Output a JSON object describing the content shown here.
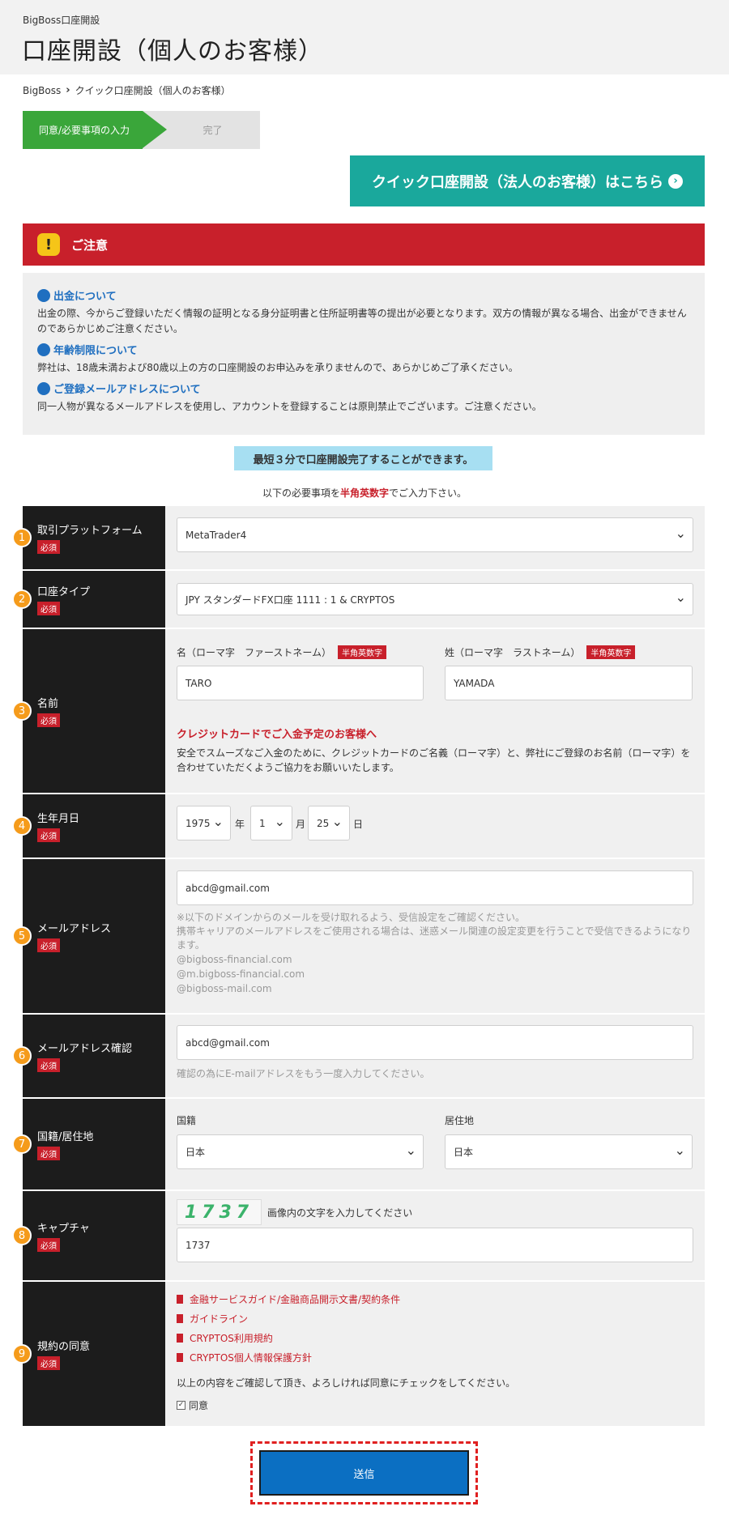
{
  "header": {
    "small": "BigBoss口座開設",
    "title": "口座開設（個人のお客様）"
  },
  "breadcrumb": {
    "home": "BigBoss",
    "current": "クイック口座開設（個人のお客様）"
  },
  "steps": {
    "step1": "同意/必要事項の入力",
    "step2": "完了"
  },
  "corp_button": "クイック口座開設（法人のお客様）はこちら",
  "notice": {
    "title": "ご注意",
    "sections": [
      {
        "heading": "出金について",
        "text": "出金の際、今からご登録いただく情報の証明となる身分証明書と住所証明書等の提出が必要となります。双方の情報が異なる場合、出金ができませんのであらかじめご注意ください。"
      },
      {
        "heading": "年齢制限について",
        "text": "弊社は、18歳未満および80歳以上の方の口座開設のお申込みを承りませんので、あらかじめご了承ください。"
      },
      {
        "heading": "ご登録メールアドレスについて",
        "text": "同一人物が異なるメールアドレスを使用し、アカウントを登録することは原則禁止でございます。ご注意ください。"
      }
    ]
  },
  "banner": "最短３分で口座開設完了することができます。",
  "subnote": {
    "pre": "以下の必要事項を",
    "red": "半角英数字",
    "post": "でご入力下さい。"
  },
  "required": "必須",
  "half_tag": "半角英数字",
  "form": {
    "platform": {
      "num": "1",
      "label": "取引プラットフォーム",
      "value": "MetaTrader4"
    },
    "account_type": {
      "num": "2",
      "label": "口座タイプ",
      "value": "JPY スタンダードFX口座 1111 : 1 & CRYPTOS"
    },
    "name": {
      "num": "3",
      "label": "名前",
      "first_label": "名（ローマ字　ファーストネーム）",
      "first_value": "TARO",
      "last_label": "姓（ローマ字　ラストネーム）",
      "last_value": "YAMADA",
      "cc_heading": "クレジットカードでご入金予定のお客様へ",
      "cc_text": "安全でスムーズなご入金のために、クレジットカードのご名義（ローマ字）と、弊社にご登録のお名前（ローマ字）を合わせていただくようご協力をお願いいたします。"
    },
    "birthday": {
      "num": "4",
      "label": "生年月日",
      "year": "1975",
      "year_unit": "年",
      "month": "1",
      "month_unit": "月",
      "day": "25",
      "day_unit": "日"
    },
    "email": {
      "num": "5",
      "label": "メールアドレス",
      "value": "abcd@gmail.com",
      "hint1": "※以下のドメインからのメールを受け取れるよう、受信設定をご確認ください。",
      "hint2": "携帯キャリアのメールアドレスをご使用される場合は、迷惑メール関連の設定変更を行うことで受信できるようになります。",
      "domains": [
        "@bigboss-financial.com",
        "@m.bigboss-financial.com",
        "@bigboss-mail.com"
      ]
    },
    "email_confirm": {
      "num": "6",
      "label": "メールアドレス確認",
      "value": "abcd@gmail.com",
      "hint": "確認の為にE-mailアドレスをもう一度入力してください。"
    },
    "nationality": {
      "num": "7",
      "label": "国籍/居住地",
      "nat_label": "国籍",
      "nat_value": "日本",
      "res_label": "居住地",
      "res_value": "日本"
    },
    "captcha": {
      "num": "8",
      "label": "キャプチャ",
      "image_text": "1737",
      "instruction": "画像内の文字を入力してください",
      "value": "1737"
    },
    "terms": {
      "num": "9",
      "label": "規約の同意",
      "links": [
        "金融サービスガイド/金融商品開示文書/契約条件",
        "ガイドライン",
        "CRYPTOS利用規約",
        "CRYPTOS個人情報保護方針"
      ],
      "confirm_text": "以上の内容をご確認して頂き、よろしければ同意にチェックをしてください。",
      "agree_label": "同意"
    }
  },
  "submit": "送信",
  "colors": {
    "green": "#3aa63a",
    "teal": "#1aa89c",
    "red": "#c8202b",
    "blue": "#0b6fc2",
    "orange": "#f59b1b"
  }
}
